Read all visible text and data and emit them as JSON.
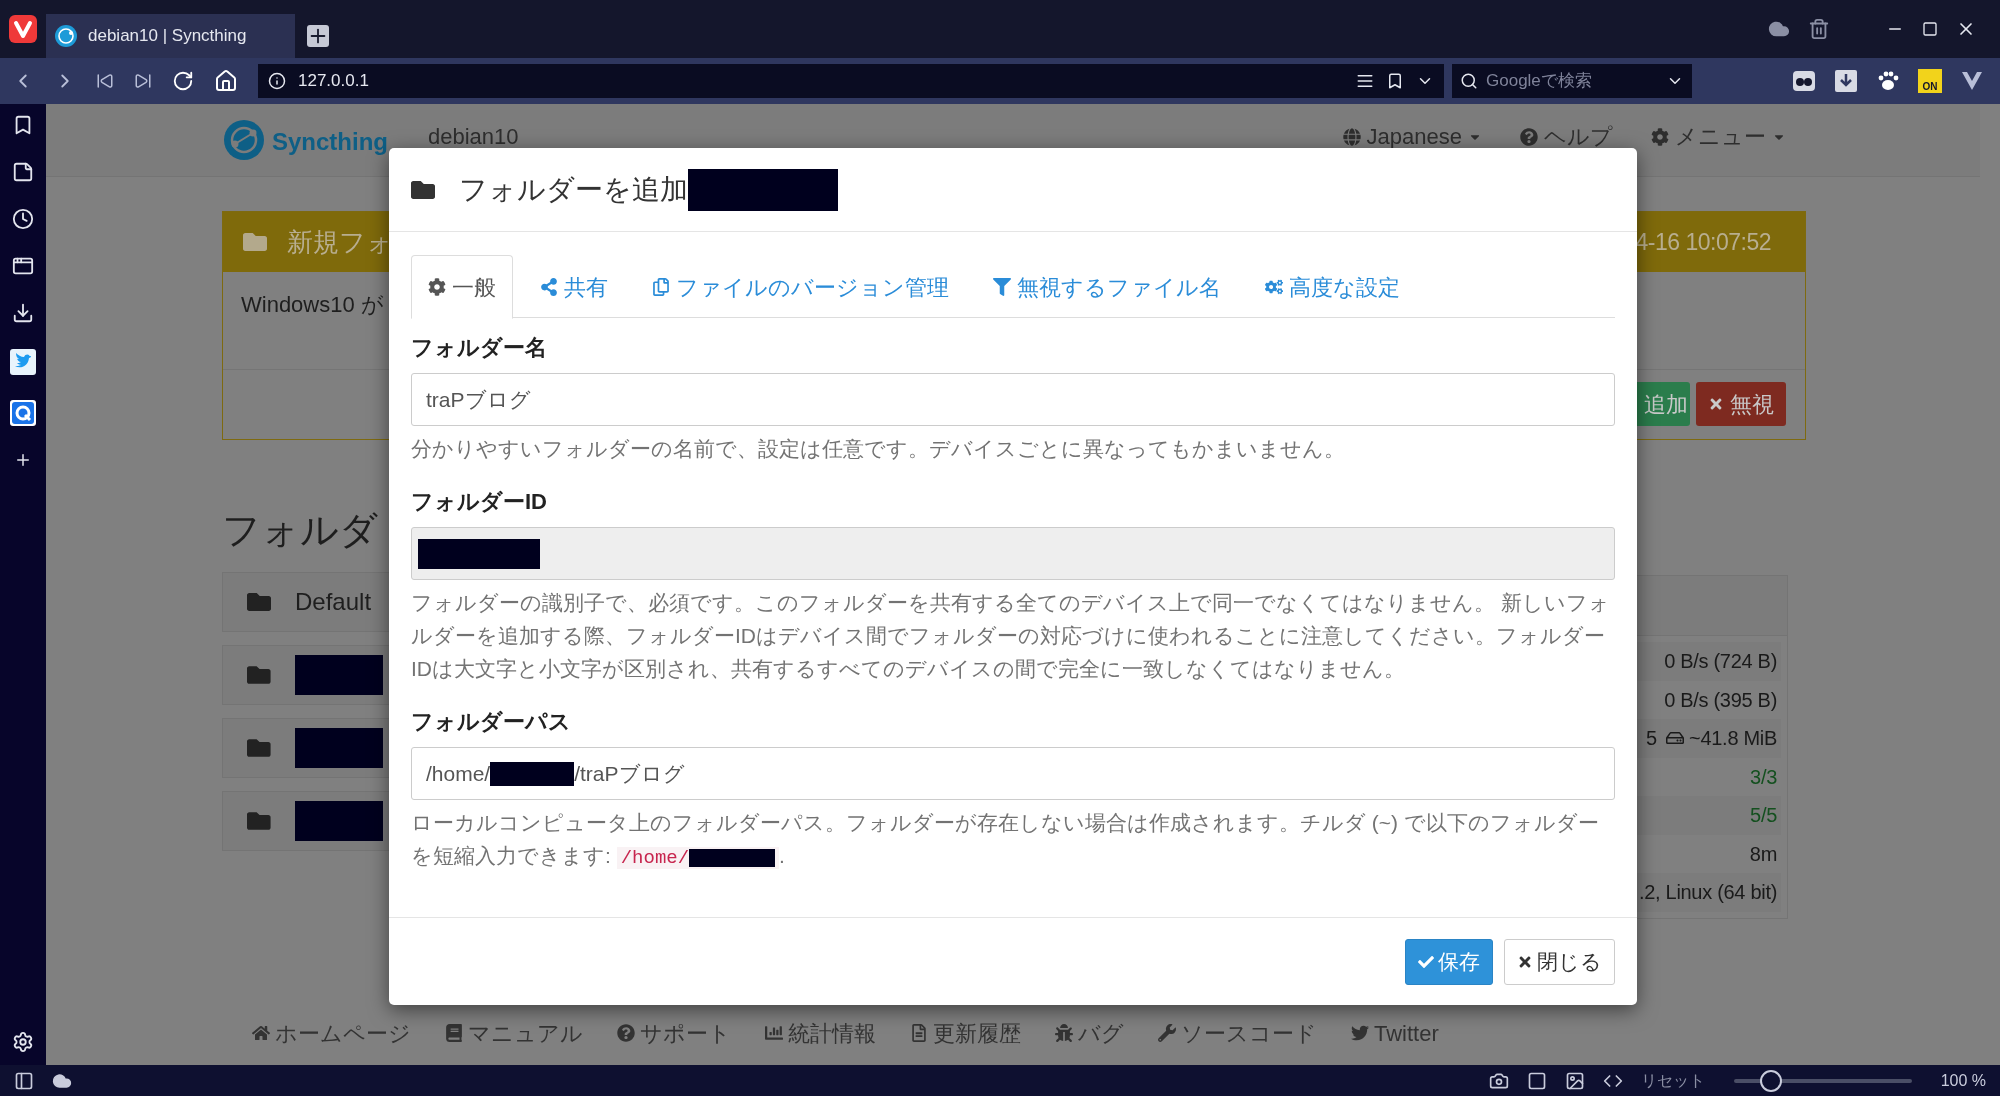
{
  "browser": {
    "tab_title": "debian10 | Syncthing",
    "address": "127.0.0.1",
    "search": {
      "placeholder": "Googleで検索"
    },
    "extension_badge": "ON"
  },
  "page": {
    "brand": "Syncthing",
    "device_name": "debian10",
    "nav": [
      {
        "label": "Japanese"
      },
      {
        "label": "ヘルプ"
      },
      {
        "label": "メニュー"
      }
    ],
    "notice": {
      "title": "新規フォ",
      "time": "4-16 10:07:52",
      "message": "Windows10 が",
      "buttons": [
        {
          "label": "追加",
          "kind": "add"
        },
        {
          "label": "無視",
          "kind": "ignore"
        }
      ]
    },
    "folders_heading": "フォルダ",
    "folders": [
      {
        "kind": "named",
        "name": "Default"
      },
      {
        "kind": "redacted"
      },
      {
        "kind": "redacted"
      },
      {
        "kind": "redacted"
      }
    ],
    "device_stats": [
      {
        "value": "0 B/s (724 B)",
        "color": "#1a1a1a"
      },
      {
        "value": "0 B/s (395 B)",
        "color": "#1a1a1a"
      },
      {
        "lead": "5",
        "value": "~41.8 MiB",
        "color": "#1a1a1a"
      },
      {
        "value": "3/3",
        "color": "#14501f"
      },
      {
        "value": "5/5",
        "color": "#14501f"
      },
      {
        "value": "8m",
        "color": "#1a1a1a"
      },
      {
        "value": ".2, Linux (64 bit)",
        "color": "#1a1a1a"
      }
    ],
    "footer_links": [
      {
        "label": "ホームページ"
      },
      {
        "label": "マニュアル"
      },
      {
        "label": "サポート"
      },
      {
        "label": "統計情報"
      },
      {
        "label": "更新履歴"
      },
      {
        "label": "バグ"
      },
      {
        "label": "ソースコード"
      },
      {
        "label": "Twitter"
      }
    ]
  },
  "modal": {
    "title": "フォルダーを追加",
    "tabs": [
      {
        "label": "一般",
        "selected": true
      },
      {
        "label": "共有",
        "selected": false
      },
      {
        "label": "ファイルのバージョン管理",
        "selected": false
      },
      {
        "label": "無視するファイル名",
        "selected": false
      },
      {
        "label": "高度な設定",
        "selected": false
      }
    ],
    "fields": [
      {
        "kind": "text",
        "label": "フォルダー名",
        "value": "traPブログ",
        "disabled": false,
        "help": "分かりやすいフォルダーの名前で、設定は任意です。デバイスごとに異なってもかまいません。"
      },
      {
        "kind": "redacted",
        "label": "フォルダーID",
        "disabled": true,
        "help": "フォルダーの識別子で、必須です。このフォルダーを共有する全てのデバイス上で同一でなくてはなりません。 新しいフォルダーを追加する際、フォルダーIDはデバイス間でフォルダーの対応づけに使われることに注意してください。フォルダーIDは大文字と小文字が区別され、共有するすべてのデバイスの間で完全に一致しなくてはなりません。"
      },
      {
        "kind": "path",
        "label": "フォルダーパス",
        "value_parts": [
          "/home/",
          "/traPブログ"
        ],
        "disabled": false,
        "help": "ローカルコンピュータ上のフォルダーパス。フォルダーが存在しない場合は作成されます。チルダ (~) で以下のフォルダーを短縮入力できます: ",
        "help_code": "/home/",
        "help_end": "."
      }
    ],
    "buttons": [
      {
        "label": "保存",
        "kind": "primary"
      },
      {
        "label": "閉じる",
        "kind": "default"
      }
    ]
  },
  "status_bar": {
    "reset": "リセット",
    "zoom": {
      "level": 0.21,
      "reading": "100 %"
    }
  }
}
